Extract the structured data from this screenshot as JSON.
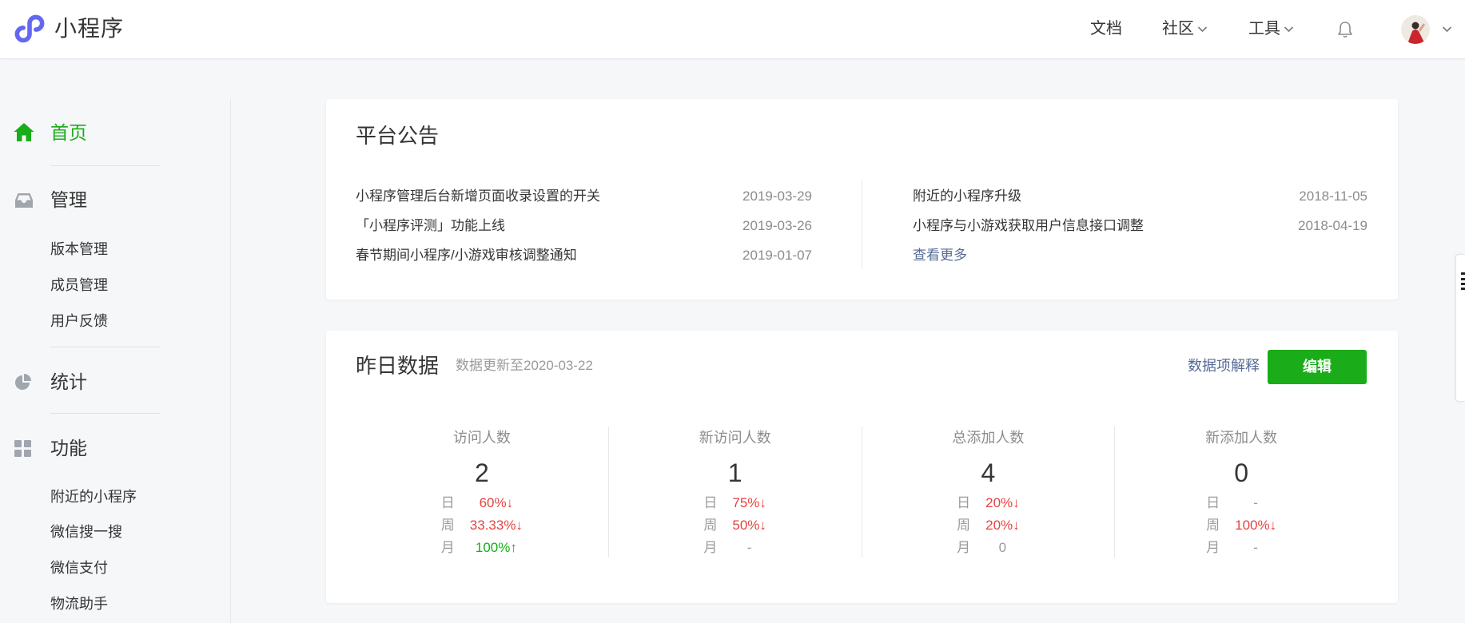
{
  "header": {
    "logo_icon": "mini-program-logo-icon",
    "logo_text": "小程序",
    "nav": [
      {
        "label": "文档"
      },
      {
        "label": "社区",
        "icon": "chevron-down-icon"
      },
      {
        "label": "工具",
        "icon": "chevron-down-icon"
      }
    ],
    "bell_icon": "bell-icon",
    "avatar_menu_icon": "chevron-down-icon"
  },
  "sidebar": {
    "sections": [
      {
        "label": "首页",
        "icon": "home-icon",
        "active": true,
        "items": []
      },
      {
        "label": "管理",
        "icon": "inbox-icon",
        "items": [
          "版本管理",
          "成员管理",
          "用户反馈"
        ]
      },
      {
        "label": "统计",
        "icon": "pie-chart-icon",
        "items": []
      },
      {
        "label": "功能",
        "icon": "grid-icon",
        "items": [
          "附近的小程序",
          "微信搜一搜",
          "微信支付",
          "物流助手"
        ]
      }
    ]
  },
  "announcements": {
    "title": "平台公告",
    "left": [
      {
        "text": "小程序管理后台新增页面收录设置的开关",
        "date": "2019-03-29"
      },
      {
        "text": "「小程序评测」功能上线",
        "date": "2019-03-26"
      },
      {
        "text": "春节期间小程序/小游戏审核调整通知",
        "date": "2019-01-07"
      }
    ],
    "right": [
      {
        "text": "附近的小程序升级",
        "date": "2018-11-05"
      },
      {
        "text": "小程序与小游戏获取用户信息接口调整",
        "date": "2018-04-19"
      }
    ],
    "more_label": "查看更多"
  },
  "yesterday": {
    "title": "昨日数据",
    "updated": "数据更新至2020-03-22",
    "explain_label": "数据项解释",
    "edit_label": "编辑",
    "stats": [
      {
        "label": "访问人数",
        "value": "2",
        "rows": [
          {
            "period": "日",
            "change": "60%↓",
            "color": "#e64340"
          },
          {
            "period": "周",
            "change": "33.33%↓",
            "color": "#e64340"
          },
          {
            "period": "月",
            "change": "100%↑",
            "color": "#1aad19"
          }
        ]
      },
      {
        "label": "新访问人数",
        "value": "1",
        "rows": [
          {
            "period": "日",
            "change": "75%↓",
            "color": "#e64340"
          },
          {
            "period": "周",
            "change": "50%↓",
            "color": "#e64340"
          },
          {
            "period": "月",
            "change": "-",
            "color": "#9a9a9a"
          }
        ]
      },
      {
        "label": "总添加人数",
        "value": "4",
        "rows": [
          {
            "period": "日",
            "change": "20%↓",
            "color": "#e64340"
          },
          {
            "period": "周",
            "change": "20%↓",
            "color": "#e64340"
          },
          {
            "period": "月",
            "change": "0",
            "color": "#9a9a9a"
          }
        ]
      },
      {
        "label": "新添加人数",
        "value": "0",
        "rows": [
          {
            "period": "日",
            "change": "-",
            "color": "#9a9a9a"
          },
          {
            "period": "周",
            "change": "100%↓",
            "color": "#e64340"
          },
          {
            "period": "月",
            "change": "-",
            "color": "#9a9a9a"
          }
        ]
      }
    ]
  },
  "colors": {
    "accent": "#1aad19",
    "link": "#576b95",
    "down": "#e64340",
    "up": "#1aad19",
    "logo": "#6467f0"
  }
}
